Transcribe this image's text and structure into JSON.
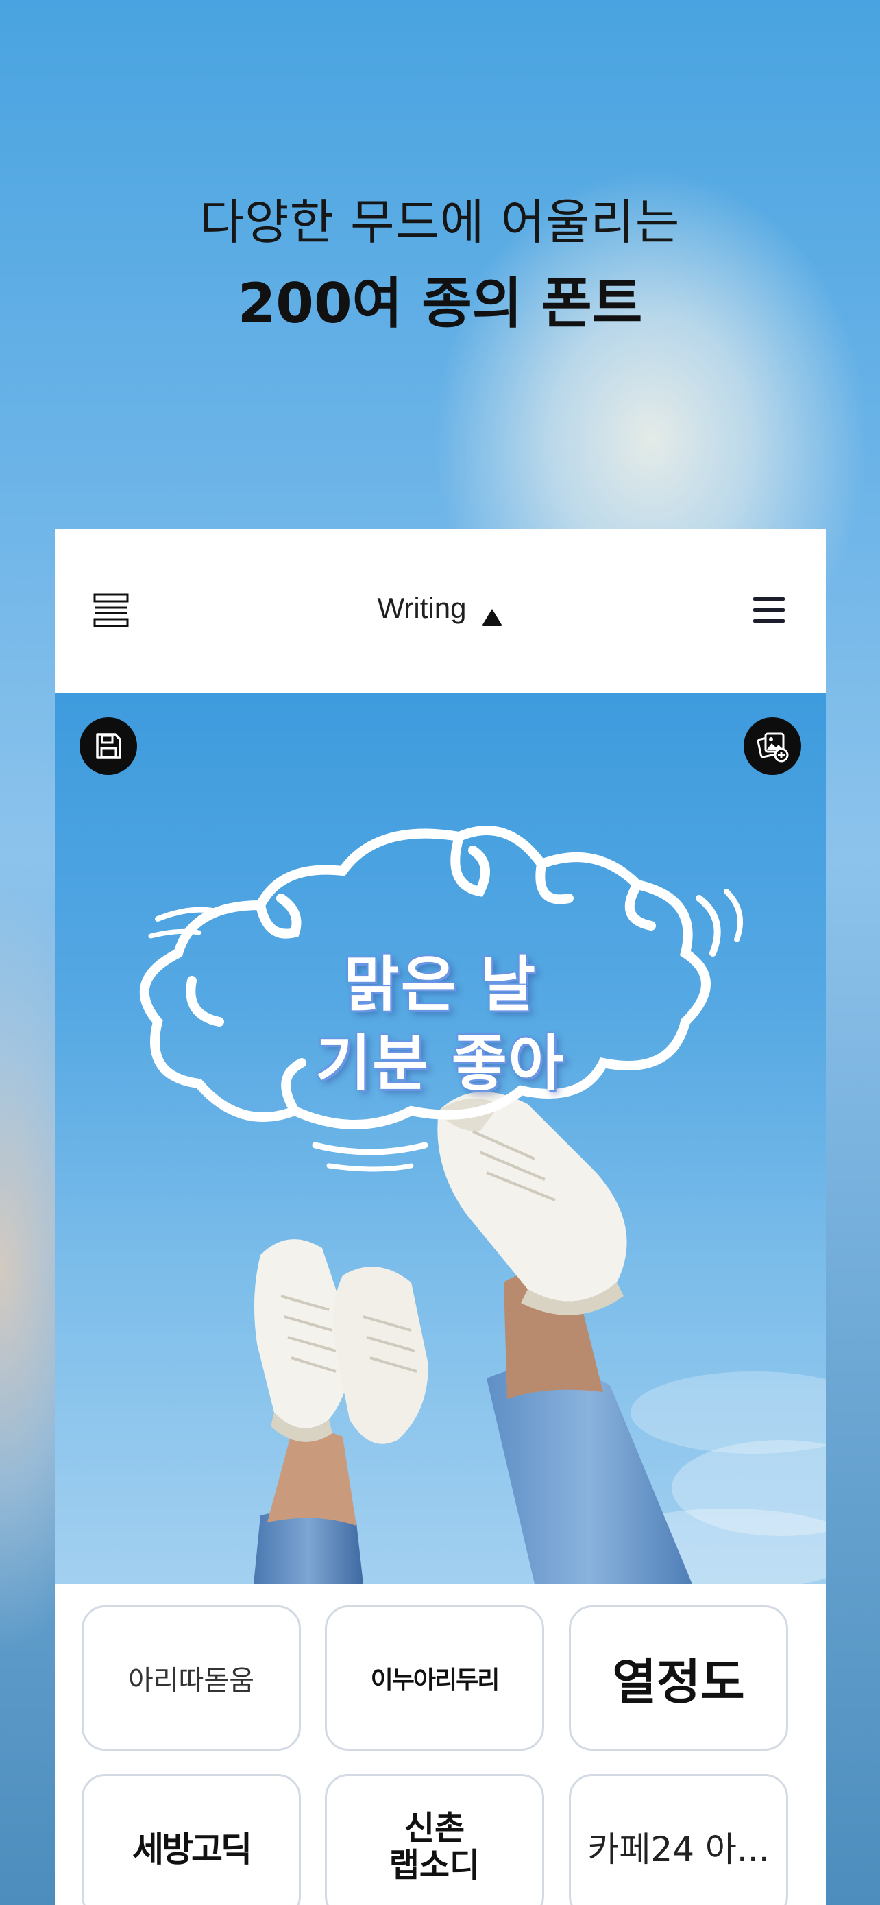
{
  "promo": {
    "line1": "다양한 무드에 어울리는",
    "line2": "200여 종의 폰트"
  },
  "topbar": {
    "left_icon": "list-layers-icon",
    "title": "Writing",
    "caret_icon": "triangle-up-icon",
    "menu_icon": "hamburger-menu-icon"
  },
  "canvas": {
    "save_icon": "floppy-save-icon",
    "add_image_icon": "add-photo-icon",
    "caption_line1": "맑은 날",
    "caption_line2": "기분 좋아",
    "sticker": "cloud-doodle",
    "photo": "sneakers-against-sky"
  },
  "fonts": [
    {
      "label": "아리따돋움"
    },
    {
      "label": "이누아리두리"
    },
    {
      "label": "열정도"
    },
    {
      "label": "세방고딕"
    },
    {
      "label_line1": "신촌",
      "label_line2": "랩소디"
    },
    {
      "label": "카페24 아..."
    }
  ],
  "colors": {
    "sky_top": "#49a3e0",
    "canvas_sky": "#3e9bdd",
    "card_border": "#d3dae3",
    "caption_outline": "#6f98e6"
  }
}
